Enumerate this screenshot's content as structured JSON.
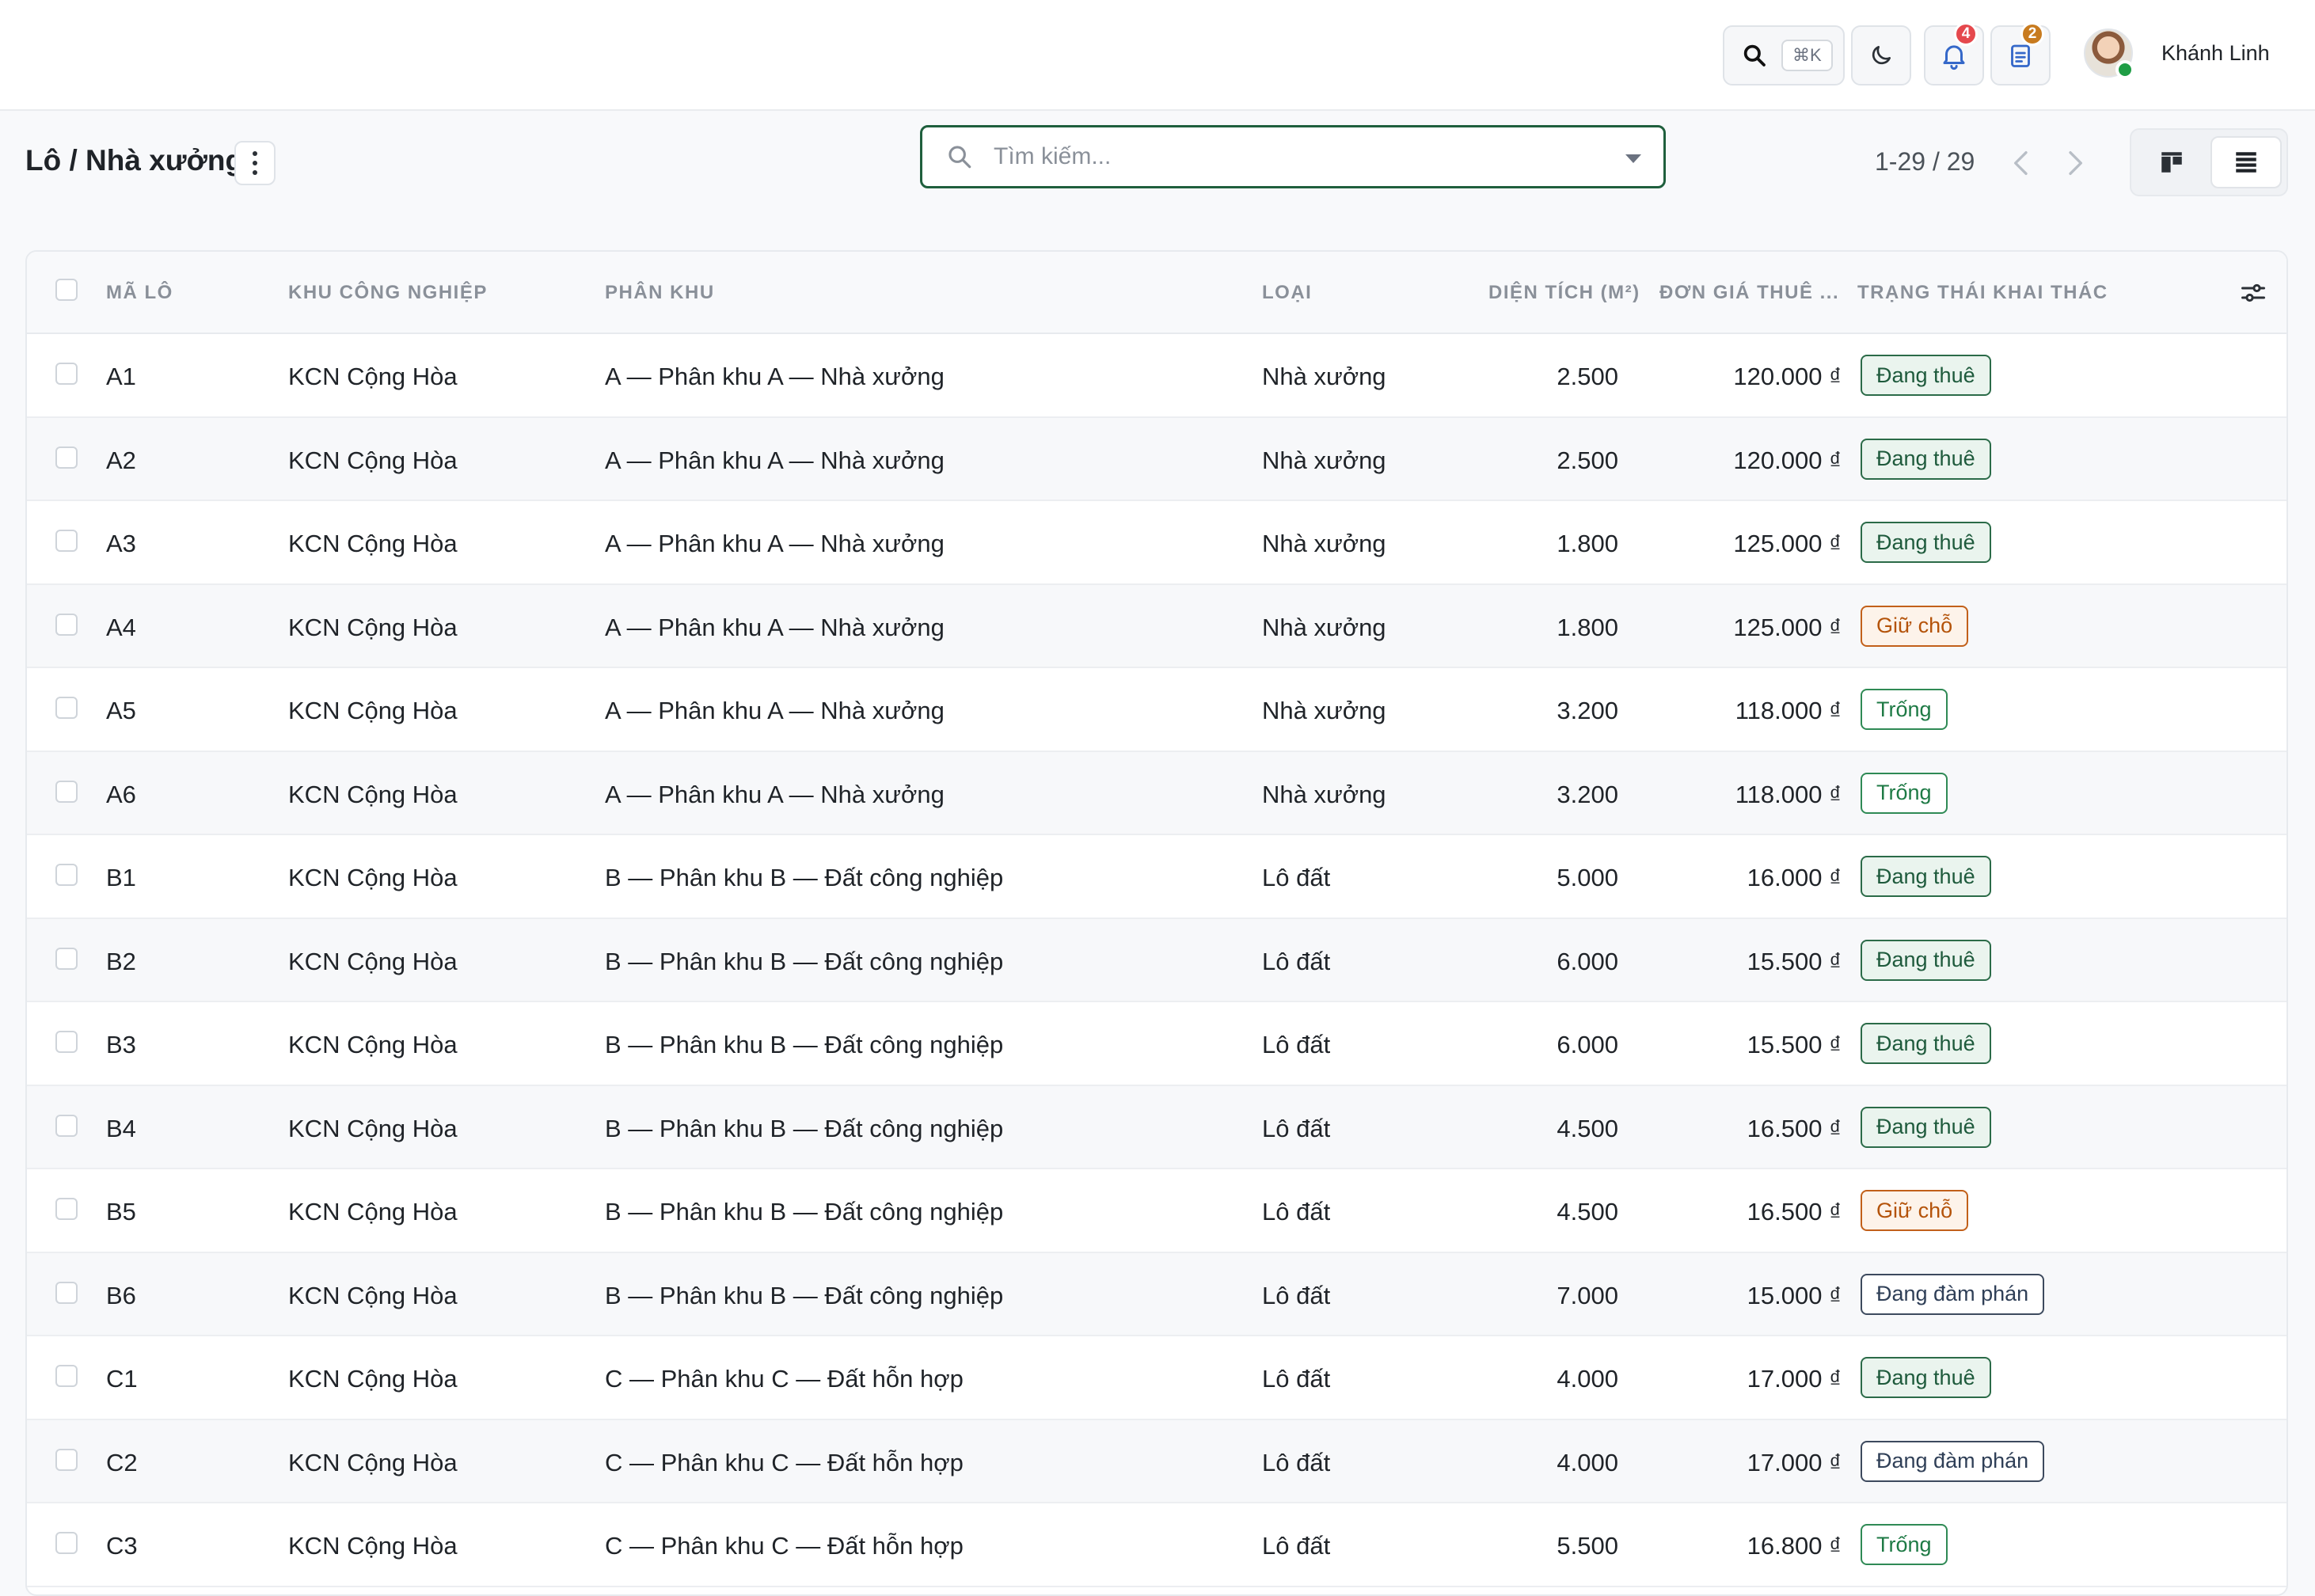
{
  "topbar": {
    "search_shortcut": "⌘K",
    "notifications_count": "4",
    "tasks_count": "2",
    "user_name": "Khánh Linh",
    "colors": {
      "notif_badge": "#e5484d",
      "tasks_badge": "#c87b1f"
    }
  },
  "control": {
    "title": "Lô / Nhà xưởng",
    "search_placeholder": "Tìm kiếm...",
    "pager_text": "1-29 / 29"
  },
  "table": {
    "headers": {
      "code": "MÃ LÔ",
      "park": "KHU CÔNG NGHIỆP",
      "zone": "PHÂN KHU",
      "type": "LOẠI",
      "area": "DIỆN TÍCH (M²)",
      "price": "ĐƠN GIÁ THUÊ ...",
      "status": "TRẠNG THÁI KHAI THÁC"
    },
    "rows": [
      {
        "code": "A1",
        "park": "KCN Cộng Hòa",
        "zone": "A — Phân khu A — Nhà xưởng",
        "type": "Nhà xưởng",
        "area": "2.500",
        "price": "120.000 ₫",
        "status": "Đang thuê",
        "status_kind": "rent"
      },
      {
        "code": "A2",
        "park": "KCN Cộng Hòa",
        "zone": "A — Phân khu A — Nhà xưởng",
        "type": "Nhà xưởng",
        "area": "2.500",
        "price": "120.000 ₫",
        "status": "Đang thuê",
        "status_kind": "rent"
      },
      {
        "code": "A3",
        "park": "KCN Cộng Hòa",
        "zone": "A — Phân khu A — Nhà xưởng",
        "type": "Nhà xưởng",
        "area": "1.800",
        "price": "125.000 ₫",
        "status": "Đang thuê",
        "status_kind": "rent"
      },
      {
        "code": "A4",
        "park": "KCN Cộng Hòa",
        "zone": "A — Phân khu A — Nhà xưởng",
        "type": "Nhà xưởng",
        "area": "1.800",
        "price": "125.000 ₫",
        "status": "Giữ chỗ",
        "status_kind": "hold"
      },
      {
        "code": "A5",
        "park": "KCN Cộng Hòa",
        "zone": "A — Phân khu A — Nhà xưởng",
        "type": "Nhà xưởng",
        "area": "3.200",
        "price": "118.000 ₫",
        "status": "Trống",
        "status_kind": "free"
      },
      {
        "code": "A6",
        "park": "KCN Cộng Hòa",
        "zone": "A — Phân khu A — Nhà xưởng",
        "type": "Nhà xưởng",
        "area": "3.200",
        "price": "118.000 ₫",
        "status": "Trống",
        "status_kind": "free"
      },
      {
        "code": "B1",
        "park": "KCN Cộng Hòa",
        "zone": "B — Phân khu B — Đất công nghiệp",
        "type": "Lô đất",
        "area": "5.000",
        "price": "16.000 ₫",
        "status": "Đang thuê",
        "status_kind": "rent"
      },
      {
        "code": "B2",
        "park": "KCN Cộng Hòa",
        "zone": "B — Phân khu B — Đất công nghiệp",
        "type": "Lô đất",
        "area": "6.000",
        "price": "15.500 ₫",
        "status": "Đang thuê",
        "status_kind": "rent"
      },
      {
        "code": "B3",
        "park": "KCN Cộng Hòa",
        "zone": "B — Phân khu B — Đất công nghiệp",
        "type": "Lô đất",
        "area": "6.000",
        "price": "15.500 ₫",
        "status": "Đang thuê",
        "status_kind": "rent"
      },
      {
        "code": "B4",
        "park": "KCN Cộng Hòa",
        "zone": "B — Phân khu B — Đất công nghiệp",
        "type": "Lô đất",
        "area": "4.500",
        "price": "16.500 ₫",
        "status": "Đang thuê",
        "status_kind": "rent"
      },
      {
        "code": "B5",
        "park": "KCN Cộng Hòa",
        "zone": "B — Phân khu B — Đất công nghiệp",
        "type": "Lô đất",
        "area": "4.500",
        "price": "16.500 ₫",
        "status": "Giữ chỗ",
        "status_kind": "hold"
      },
      {
        "code": "B6",
        "park": "KCN Cộng Hòa",
        "zone": "B — Phân khu B — Đất công nghiệp",
        "type": "Lô đất",
        "area": "7.000",
        "price": "15.000 ₫",
        "status": "Đang đàm phán",
        "status_kind": "nego"
      },
      {
        "code": "C1",
        "park": "KCN Cộng Hòa",
        "zone": "C — Phân khu C — Đất hỗn hợp",
        "type": "Lô đất",
        "area": "4.000",
        "price": "17.000 ₫",
        "status": "Đang thuê",
        "status_kind": "rent"
      },
      {
        "code": "C2",
        "park": "KCN Cộng Hòa",
        "zone": "C — Phân khu C — Đất hỗn hợp",
        "type": "Lô đất",
        "area": "4.000",
        "price": "17.000 ₫",
        "status": "Đang đàm phán",
        "status_kind": "nego"
      },
      {
        "code": "C3",
        "park": "KCN Cộng Hòa",
        "zone": "C — Phân khu C — Đất hỗn hợp",
        "type": "Lô đất",
        "area": "5.500",
        "price": "16.800 ₫",
        "status": "Trống",
        "status_kind": "free"
      }
    ]
  },
  "icons": {
    "search": "search-icon",
    "theme": "moon-icon",
    "notifications": "bell-icon",
    "tasks": "clipboard-icon",
    "kebab": "kebab-menu-icon",
    "prev": "chevron-left-icon",
    "next": "chevron-right-icon",
    "kanban": "kanban-view-icon",
    "list": "list-view-icon",
    "columns": "column-settings-icon"
  }
}
